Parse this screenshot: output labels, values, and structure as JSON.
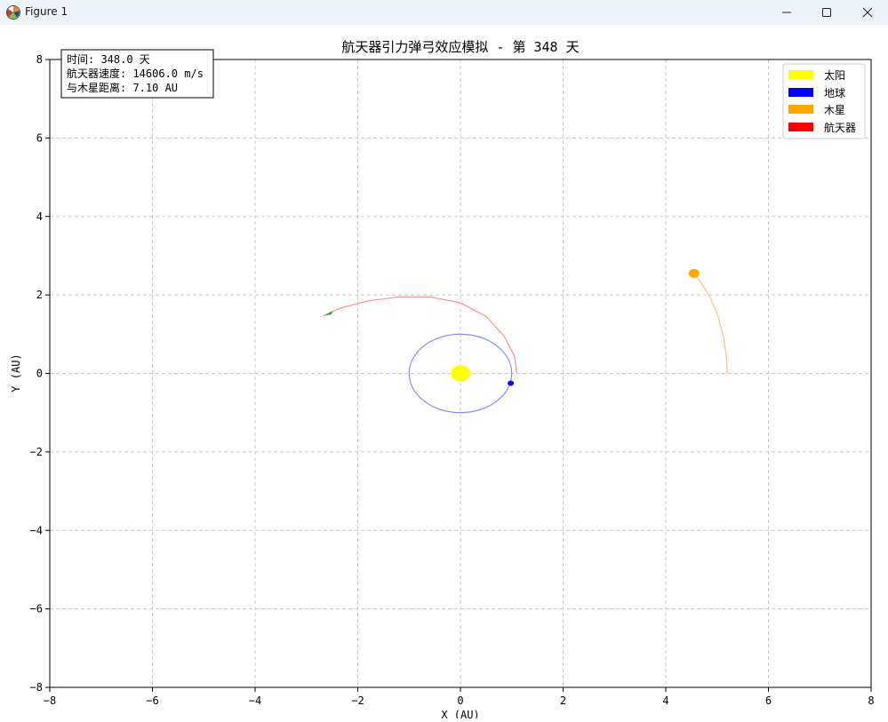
{
  "window": {
    "title": "Figure 1",
    "controls": {
      "minimize": "minimize-icon",
      "maximize": "maximize-icon",
      "close": "close-icon"
    }
  },
  "chart_data": {
    "type": "scatter",
    "title": "航天器引力弹弓效应模拟 - 第 348 天",
    "xlabel": "X (AU)",
    "ylabel": "Y (AU)",
    "xlim": [
      -8,
      8
    ],
    "ylim": [
      -8,
      8
    ],
    "xticks": [
      -8,
      -6,
      -4,
      -2,
      0,
      2,
      4,
      6,
      8
    ],
    "yticks": [
      -8,
      -6,
      -4,
      -2,
      0,
      2,
      4,
      6,
      8
    ],
    "grid": true,
    "grid_style": "dashed",
    "legend_position": "top-right",
    "info_box": {
      "lines": [
        "时间: 348.0 天",
        "航天器速度: 14606.0 m/s",
        "与木星距离: 7.10 AU"
      ]
    },
    "series": [
      {
        "name": "太阳",
        "color": "#ffff00",
        "point": [
          0,
          0
        ]
      },
      {
        "name": "地球",
        "color": "#0000ff",
        "point": [
          0.98,
          -0.25
        ],
        "orbit_color": "#8080ff"
      },
      {
        "name": "木星",
        "color": "#ffa500",
        "point": [
          4.55,
          2.55
        ],
        "trail_color": "#ffc080",
        "trail": [
          [
            5.2,
            0.0
          ],
          [
            5.18,
            0.45
          ],
          [
            5.12,
            0.95
          ],
          [
            5.02,
            1.45
          ],
          [
            4.88,
            1.9
          ],
          [
            4.72,
            2.25
          ],
          [
            4.55,
            2.55
          ]
        ]
      },
      {
        "name": "航天器",
        "color": "#ff0000",
        "marker_color": "#2ca02c",
        "point": [
          -2.55,
          1.55
        ],
        "trail_color": "#ff9090",
        "trail": [
          [
            1.1,
            0.0
          ],
          [
            1.05,
            0.45
          ],
          [
            0.85,
            0.95
          ],
          [
            0.5,
            1.45
          ],
          [
            0.0,
            1.8
          ],
          [
            -0.6,
            1.95
          ],
          [
            -1.2,
            1.95
          ],
          [
            -1.8,
            1.85
          ],
          [
            -2.3,
            1.68
          ],
          [
            -2.55,
            1.55
          ]
        ]
      }
    ]
  }
}
